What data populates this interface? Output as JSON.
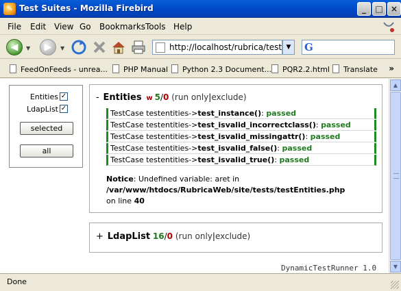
{
  "window": {
    "title": "Test Suites - Mozilla Firebird",
    "controls": {
      "minimize": "_",
      "maximize": "□",
      "close": "×"
    }
  },
  "menu": [
    "File",
    "Edit",
    "View",
    "Go",
    "Bookmarks",
    "Tools",
    "Help"
  ],
  "address": {
    "url": "http://localhost/rubrica/tests/?sui",
    "search_placeholder": ""
  },
  "bookmarks": [
    "FeedOnFeeds - unrea...",
    "PHP Manual",
    "Python 2.3 Document...",
    "PQR2.2.html",
    "Translate"
  ],
  "filter": {
    "items": [
      {
        "label": "Entities",
        "checked": true
      },
      {
        "label": "LdapList",
        "checked": true
      }
    ],
    "selected_button": "selected",
    "all_button": "all"
  },
  "suites": [
    {
      "expand_sign": "-",
      "name": "Entities",
      "warning": "w",
      "passed": "5",
      "failed": "0",
      "run_only": "(run only",
      "exclude": "exclude)",
      "cases": [
        {
          "prefix": "TestCase testentities->",
          "method": "test_instance()",
          "sep": ": ",
          "result": "passed"
        },
        {
          "prefix": "TestCase testentities->",
          "method": "test_isvalid_incorrectclass()",
          "sep": ": ",
          "result": "passed"
        },
        {
          "prefix": "TestCase testentities->",
          "method": "test_isvalid_missingattr()",
          "sep": ": ",
          "result": "passed"
        },
        {
          "prefix": "TestCase testentities->",
          "method": "test_isvalid_false()",
          "sep": ": ",
          "result": "passed"
        },
        {
          "prefix": "TestCase testentities->",
          "method": "test_isvalid_true()",
          "sep": ": ",
          "result": "passed"
        }
      ],
      "notice": {
        "label": "Notice",
        "message": ": Undefined variable: aret in",
        "path": "/var/www/htdocs/RubricaWeb/site/tests/testEntities.php",
        "line_text": "on line",
        "line_no": "40"
      }
    },
    {
      "expand_sign": "+",
      "name": "LdapList",
      "passed": "16",
      "failed": "0",
      "run_only": "(run only",
      "exclude": "exclude)"
    }
  ],
  "runner_label": "DynamicTestRunner 1.0",
  "status": "Done",
  "colors": {
    "pass": "#1f7a1f",
    "fail": "#b00000",
    "titlebar": "#0046c7"
  }
}
